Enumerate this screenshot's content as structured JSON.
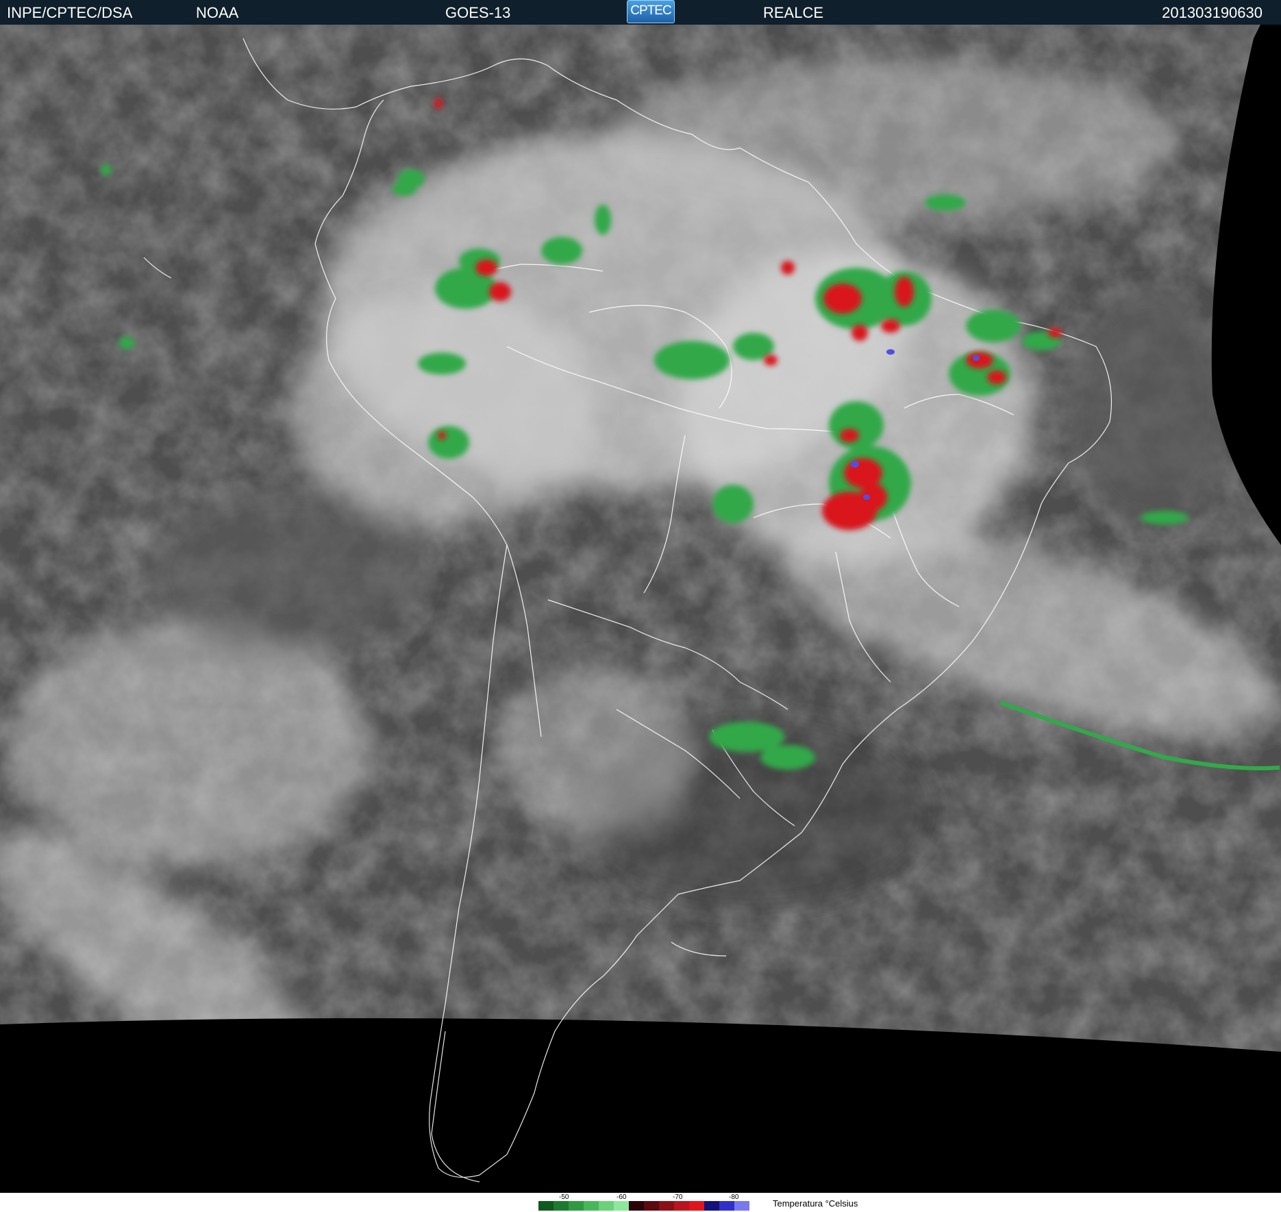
{
  "header": {
    "agency": "INPE/CPTEC/DSA",
    "source": "NOAA",
    "satellite": "GOES-13",
    "logo_text": "CPTEC",
    "product": "REALCE",
    "timestamp": "201303190630"
  },
  "legend": {
    "ticks": [
      "-50",
      "-60",
      "-70",
      "-80"
    ],
    "label": "Temperatura °Celsius",
    "colors": [
      "#0f5a1f",
      "#1e7a30",
      "#2f9a42",
      "#47b85a",
      "#6ad27a",
      "#8ee89c",
      "#2a0508",
      "#5a0a10",
      "#8a1018",
      "#b81520",
      "#e0141c",
      "#12127a",
      "#3030c8",
      "#7878f0"
    ]
  },
  "image": {
    "description_colors": {
      "background_clouds": "#9a9a9a",
      "cold_cloud_green": "#33a84a",
      "very_cold_red": "#d8121a",
      "coldest_blue": "#5050e0",
      "space": "#000000",
      "borders": "#ffffff"
    }
  }
}
